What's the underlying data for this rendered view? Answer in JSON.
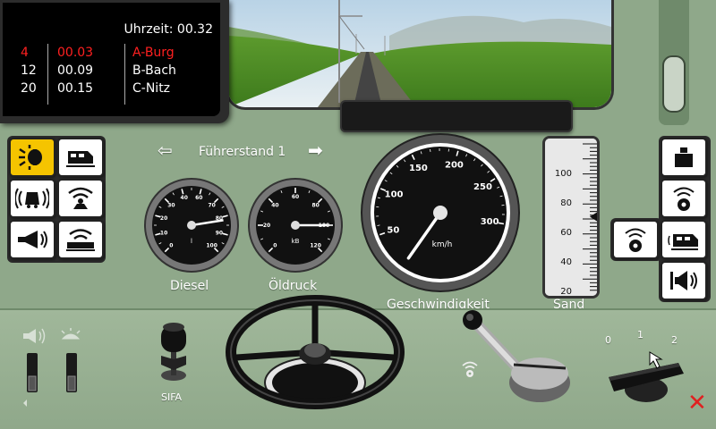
{
  "timetable": {
    "clock": "Uhrzeit: 00.32",
    "rows": [
      {
        "track": "4",
        "time": "00.03",
        "station": "A-Burg"
      },
      {
        "track": "12",
        "time": "00.09",
        "station": "B-Bach"
      },
      {
        "track": "20",
        "time": "00.15",
        "station": "C-Nitz"
      }
    ]
  },
  "cab": {
    "title": "Führerstand 1",
    "prev_arrow": "⇦",
    "next_arrow": "➡"
  },
  "gauges": {
    "diesel": {
      "label": "Diesel",
      "unit": "l",
      "ticks": [
        "0",
        "10",
        "20",
        "30",
        "40",
        "60",
        "70",
        "80",
        "90",
        "100"
      ],
      "value": 80
    },
    "oil": {
      "label": "Öldruck",
      "unit": "kB",
      "ticks": [
        "0",
        "20",
        "40",
        "60",
        "80",
        "100",
        "120"
      ],
      "value": 100
    },
    "speed": {
      "label": "Geschwindigkeit",
      "unit": "km/h",
      "ticks": [
        "50",
        "100",
        "150",
        "200",
        "250",
        "300"
      ],
      "value": 0
    }
  },
  "sand": {
    "label": "Sand",
    "ticks": [
      "100",
      "80",
      "60",
      "40",
      "20"
    ],
    "level": 70
  },
  "sifa": {
    "label": "SIFA"
  },
  "switch": {
    "positions": [
      "0",
      "1",
      "2"
    ]
  },
  "icons": {
    "left_panel": [
      "headlight-icon",
      "locomotive-icon",
      "horn-wave-icon",
      "radio-antenna-icon",
      "horn-icon",
      "train-radio-icon"
    ],
    "right_panel": [
      "weight-icon",
      "speaker-icon",
      "radio-icon",
      "loco-signal-icon",
      "megaphone-icon"
    ]
  },
  "close_symbol": "✕"
}
